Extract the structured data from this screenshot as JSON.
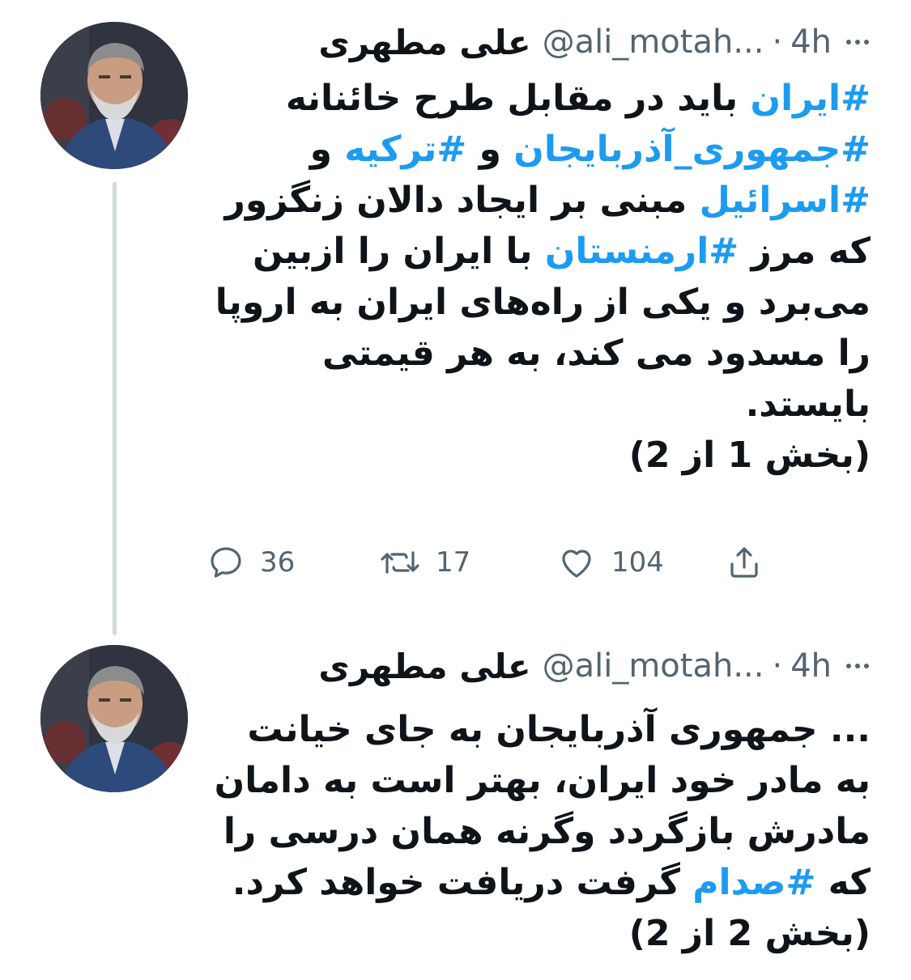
{
  "tweets": [
    {
      "author_name": "علی مطهری",
      "handle": "@ali_motah...",
      "separator": "·",
      "time": "4h",
      "lines": [
        [
          {
            "text": "#ایران",
            "hashtag": true
          },
          {
            "text": " باید در مقابل طرح خائنانه",
            "hashtag": false
          }
        ],
        [
          {
            "text": "#جمهوری_آذربایجان",
            "hashtag": true
          },
          {
            "text": " و ",
            "hashtag": false
          },
          {
            "text": "#ترکیه",
            "hashtag": true
          },
          {
            "text": " و",
            "hashtag": false
          }
        ],
        [
          {
            "text": "#اسرائیل",
            "hashtag": true
          },
          {
            "text": " مبنی بر ایجاد دالان زنگزور",
            "hashtag": false
          }
        ],
        [
          {
            "text": "که مرز ",
            "hashtag": false
          },
          {
            "text": "#ارمنستان",
            "hashtag": true
          },
          {
            "text": " با ایران را ازبین",
            "hashtag": false
          }
        ],
        [
          {
            "text": "می‌برد و یکی از راه‌های ایران به اروپا",
            "hashtag": false
          }
        ],
        [
          {
            "text": "را مسدود می کند، به هر قیمتی",
            "hashtag": false
          }
        ],
        [
          {
            "text": "بایستد.",
            "hashtag": false
          }
        ],
        [
          {
            "text": "(بخش 1 از 2)",
            "hashtag": false
          }
        ]
      ],
      "actions": {
        "reply_count": "36",
        "retweet_count": "17",
        "like_count": "104"
      }
    },
    {
      "author_name": "علی مطهری",
      "handle": "@ali_motah...",
      "separator": "·",
      "time": "4h",
      "lines": [
        [
          {
            "text": "... جمهوری آذربایجان به جای خیانت",
            "hashtag": false
          }
        ],
        [
          {
            "text": "به مادر خود ایران، بهتر است به دامان",
            "hashtag": false
          }
        ],
        [
          {
            "text": "مادرش بازگردد وگرنه همان درسی را",
            "hashtag": false
          }
        ],
        [
          {
            "text": "که ",
            "hashtag": false
          },
          {
            "text": "#صدام",
            "hashtag": true
          },
          {
            "text": " گرفت دریافت خواهد کرد.",
            "hashtag": false
          }
        ],
        [
          {
            "text": "(بخش 2 از 2)",
            "hashtag": false
          }
        ]
      ]
    }
  ],
  "icons": {
    "reply": "reply-icon",
    "retweet": "retweet-icon",
    "like": "like-icon",
    "share": "share-icon",
    "more": "more-options-icon"
  },
  "colors": {
    "hashtag": "#1d9bf0",
    "secondary_text": "#536471",
    "primary_text": "#0f1419",
    "thread_line": "#cfd9de"
  }
}
